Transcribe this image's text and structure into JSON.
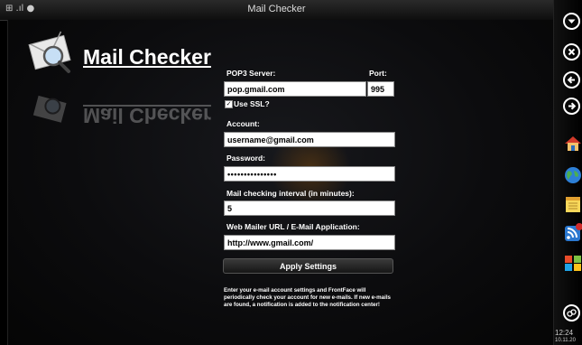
{
  "window": {
    "title": "Mail Checker",
    "status_glyphs": "⊞ .ıl ●"
  },
  "app": {
    "name": "Mail Checker"
  },
  "form": {
    "pop3_label": "POP3 Server:",
    "pop3_value": "pop.gmail.com",
    "port_label": "Port:",
    "port_value": "995",
    "ssl_label": "Use SSL?",
    "ssl_checked": true,
    "account_label": "Account:",
    "account_value": "username@gmail.com",
    "password_label": "Password:",
    "password_value": "•••••••••••••••",
    "interval_label": "Mail checking interval (in minutes):",
    "interval_value": "5",
    "webmailer_label": "Web Mailer URL / E-Mail Application:",
    "webmailer_value": "http://www.gmail.com/",
    "apply_label": "Apply Settings",
    "help_text": "Enter your e-mail account settings and FrontFace will periodically check your account for new e-mails. If new e-mails are found, a notification is added to the notification center!"
  },
  "sidebar": {
    "nav": [
      {
        "icon": "chevron-down-icon",
        "glyph": "▾"
      },
      {
        "icon": "close-icon",
        "glyph": "✕"
      },
      {
        "icon": "arrow-left-icon",
        "glyph": "←"
      },
      {
        "icon": "arrow-right-icon",
        "glyph": "→"
      }
    ],
    "apps": [
      "home-icon",
      "globe-icon",
      "notepad-icon",
      "rss-icon",
      "windows-icon"
    ],
    "clock_time": "12:24",
    "clock_date": "10.11.20"
  },
  "colors": {
    "background": "#000000",
    "input_bg": "#ffffff",
    "glow": "#ff8c00"
  }
}
